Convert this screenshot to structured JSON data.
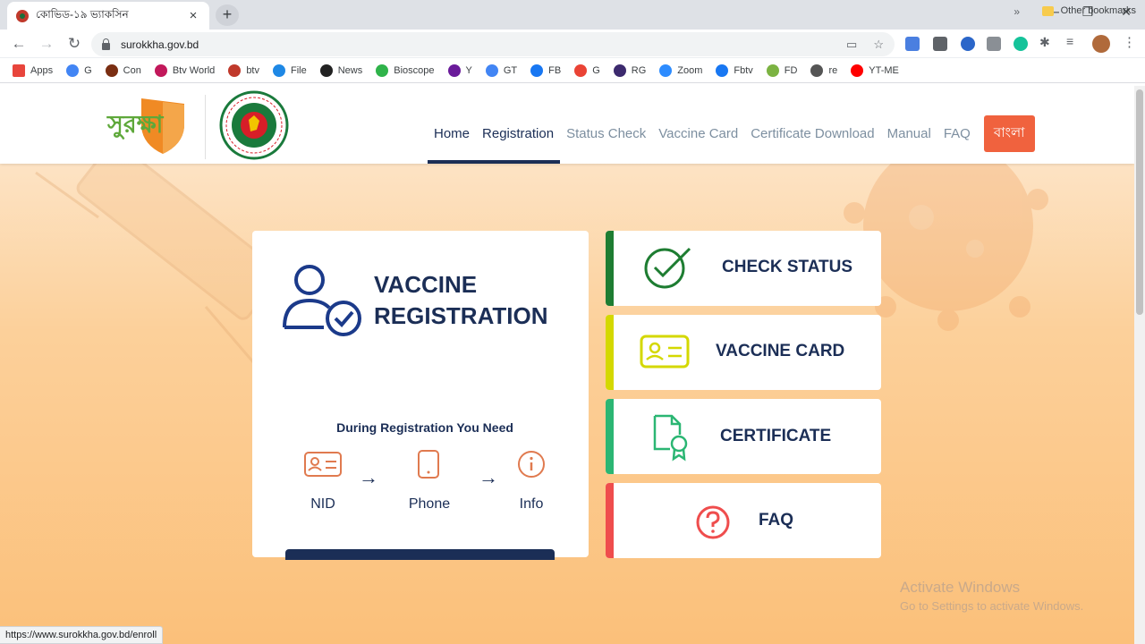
{
  "browser": {
    "tab_title": "কোভিড-১৯ ভ্যাকসিন",
    "tab_close": "×",
    "new_tab": "+",
    "url": "surokkha.gov.bd",
    "bookmarks": [
      {
        "label": "Apps",
        "color": "#e8453c"
      },
      {
        "label": "G",
        "color": "#4285f4"
      },
      {
        "label": "Con",
        "color": "#7a2e12"
      },
      {
        "label": "Btv World",
        "color": "#c2185b"
      },
      {
        "label": "btv",
        "color": "#c0392b"
      },
      {
        "label": "File",
        "color": "#1e88e5"
      },
      {
        "label": "News",
        "color": "#222222"
      },
      {
        "label": "Bioscope",
        "color": "#2fb34a"
      },
      {
        "label": "Y",
        "color": "#6a1b9a"
      },
      {
        "label": "GT",
        "color": "#4285f4"
      },
      {
        "label": "FB",
        "color": "#1877f2"
      },
      {
        "label": "G",
        "color": "#ea4335"
      },
      {
        "label": "RG",
        "color": "#3c2a6e"
      },
      {
        "label": "Zoom",
        "color": "#2d8cff"
      },
      {
        "label": "Fbtv",
        "color": "#1877f2"
      },
      {
        "label": "FD",
        "color": "#7cb342"
      },
      {
        "label": "re",
        "color": "#555555"
      },
      {
        "label": "YT-ME",
        "color": "#ff0000"
      }
    ],
    "bookmarks_more": "»",
    "other_bookmarks": "Other bookmarks",
    "status_url": "https://www.surokkha.gov.bd/enroll"
  },
  "header": {
    "logo_text": "সুরক্ষা",
    "nav": [
      {
        "label": "Home",
        "active": true
      },
      {
        "label": "Registration",
        "active": true
      },
      {
        "label": "Status Check",
        "active": false
      },
      {
        "label": "Vaccine Card",
        "active": false
      },
      {
        "label": "Certificate Download",
        "active": false
      },
      {
        "label": "Manual",
        "active": false
      },
      {
        "label": "FAQ",
        "active": false
      }
    ],
    "lang_button": "বাংলা"
  },
  "registration_card": {
    "title_line1": "VACCINE",
    "title_line2": "REGISTRATION",
    "need_heading": "During Registration You Need",
    "steps": [
      "NID",
      "Phone",
      "Info"
    ]
  },
  "side_cards": [
    {
      "label": "CHECK STATUS",
      "bar_color": "#1e7d32",
      "icon": "check-circle-icon"
    },
    {
      "label": "VACCINE CARD",
      "bar_color": "#d4d800",
      "icon": "id-card-icon"
    },
    {
      "label": "CERTIFICATE",
      "bar_color": "#2bb673",
      "icon": "certificate-icon"
    },
    {
      "label": "FAQ",
      "bar_color": "#ef4d4d",
      "icon": "question-icon"
    }
  ],
  "watermark": {
    "line1": "Activate Windows",
    "line2": "Go to Settings to activate Windows."
  },
  "colors": {
    "navy": "#1b2e56",
    "orange": "#f0623e",
    "hero": "#fbc07a"
  }
}
